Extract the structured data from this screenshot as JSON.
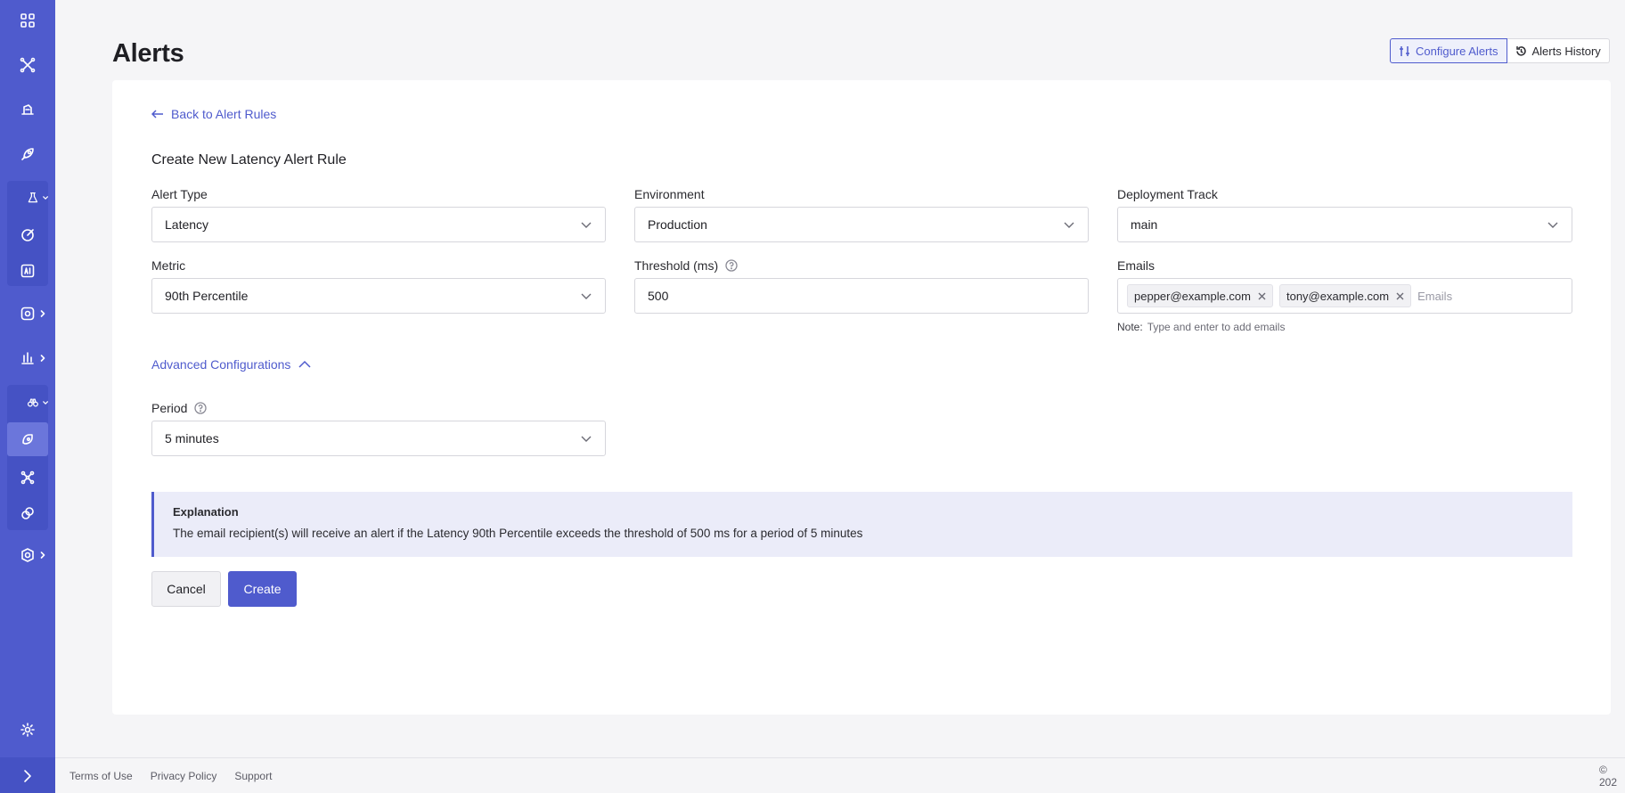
{
  "header": {
    "title": "Alerts",
    "configure_label": "Configure Alerts",
    "history_label": "Alerts History"
  },
  "form": {
    "back_label": "Back to Alert Rules",
    "title": "Create New Latency Alert Rule",
    "alert_type": {
      "label": "Alert Type",
      "value": "Latency"
    },
    "environment": {
      "label": "Environment",
      "value": "Production"
    },
    "deployment_track": {
      "label": "Deployment Track",
      "value": "main"
    },
    "metric": {
      "label": "Metric",
      "value": "90th Percentile"
    },
    "threshold": {
      "label": "Threshold (ms)",
      "value": "500"
    },
    "emails": {
      "label": "Emails",
      "chips": [
        "pepper@example.com",
        "tony@example.com"
      ],
      "placeholder": "Emails",
      "note_label": "Note:",
      "note_text": "Type and enter to add emails"
    },
    "advanced_label": "Advanced Configurations",
    "period": {
      "label": "Period",
      "value": "5 minutes"
    },
    "explanation": {
      "title": "Explanation",
      "text": "The email recipient(s) will receive an alert if the Latency 90th Percentile exceeds the threshold of 500 ms for a period of 5 minutes"
    },
    "cancel_label": "Cancel",
    "create_label": "Create"
  },
  "footer": {
    "terms": "Terms of Use",
    "privacy": "Privacy Policy",
    "support": "Support",
    "copyright": "© 202"
  },
  "colors": {
    "accent": "#4f5bcd",
    "sidebar": "#4f5bcd",
    "explanation_bg": "#ebecf9"
  }
}
